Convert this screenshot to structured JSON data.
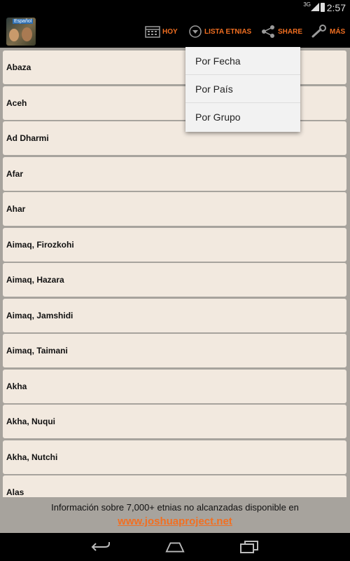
{
  "status_bar": {
    "network": "3G",
    "time": "2:57"
  },
  "action_bar": {
    "logo_tag": "Español",
    "actions": [
      {
        "label": "HOY",
        "icon": "calendar-icon"
      },
      {
        "label": "LISTA ETNIAS",
        "icon": "dropdown-circle-icon"
      },
      {
        "label": "SHARE",
        "icon": "share-icon"
      },
      {
        "label": "MÁS",
        "icon": "wrench-icon"
      }
    ]
  },
  "dropdown": {
    "items": [
      "Por Fecha",
      "Por País",
      "Por Grupo"
    ]
  },
  "list": {
    "items": [
      "Abaza",
      "Aceh",
      "Ad Dharmi",
      "Afar",
      "Ahar",
      "Aimaq, Firozkohi",
      "Aimaq, Hazara",
      "Aimaq, Jamshidi",
      "Aimaq, Taimani",
      "Akha",
      "Akha, Nuqui",
      "Akha, Nutchi",
      "Alas"
    ]
  },
  "footer": {
    "info": "Información sobre 7,000+ etnias no alcanzadas disponible en",
    "link": "www.joshuaproject.net"
  },
  "nav_bar": {
    "buttons": [
      "back-icon",
      "home-icon",
      "recent-apps-icon"
    ]
  },
  "colors": {
    "accent": "#f26f21",
    "row_bg": "#f2e9df",
    "background": "#a7a39d"
  }
}
